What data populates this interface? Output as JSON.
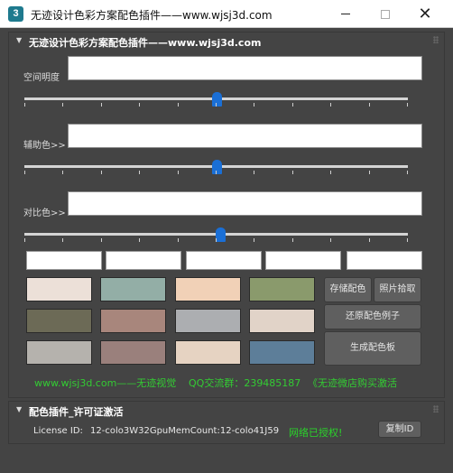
{
  "window": {
    "icon_text": "3",
    "title": "无迹设计色彩方案配色插件——www.wjsj3d.com",
    "minimize": "",
    "maximize": "",
    "close": "✕"
  },
  "main_rollout": {
    "title": "无迹设计色彩方案配色插件——www.wjsj3d.com",
    "fields": [
      {
        "label": "空间明度",
        "value": ""
      },
      {
        "label": "辅助色>>",
        "value": ""
      },
      {
        "label": "对比色>>",
        "value": ""
      }
    ],
    "sliders": [
      {
        "value_fraction": 0.5
      },
      {
        "value_fraction": 0.5
      },
      {
        "value_fraction": 0.51
      }
    ],
    "hex_fields": [
      "",
      "",
      "",
      "",
      ""
    ],
    "swatch_colors": [
      "#ece0d8",
      "#93aea6",
      "#f1d1b7",
      "#8a9a6c",
      "#6c6a56",
      "#a8867c",
      "#acaeb1",
      "#e1d3c8",
      "#b5b2ad",
      "#9a807c",
      "#e6d3c2",
      "#5d7e99"
    ],
    "buttons": {
      "save_colors": "存储配色",
      "pick_photo": "照片拾取",
      "restore_example": "还原配色例子",
      "generate_board": "生成配色板"
    },
    "footer": {
      "site": "www.wjsj3d.com——无迹视觉",
      "qq": "QQ交流群：239485187",
      "shop": "《无迹微店购买激活"
    }
  },
  "license_rollout": {
    "title": "配色插件_许可证激活",
    "license_label": "License ID:",
    "license_value": "12-colo3W32GpuMemCount:12-colo41J59",
    "auth_status": "网络已授权!",
    "copy_button": "复制ID"
  },
  "colors": {
    "panel_bg": "#444444",
    "status_green": "#33cc33",
    "slider_thumb": "#1a6fd6"
  }
}
